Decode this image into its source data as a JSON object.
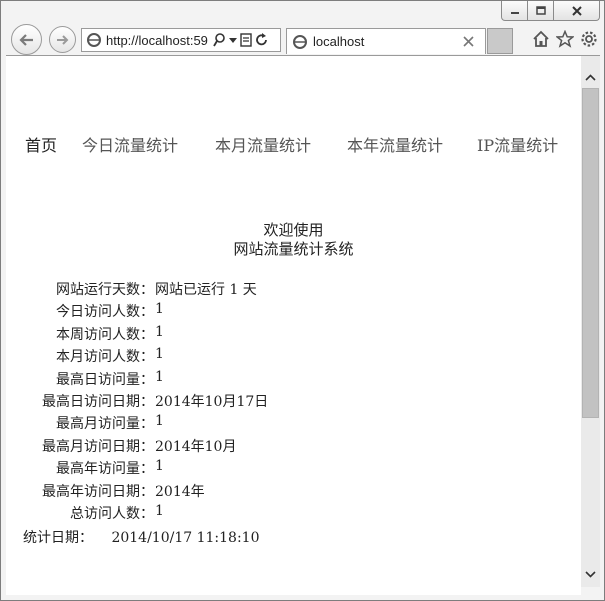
{
  "browser": {
    "address_url": "http://localhost:59",
    "tab_title": "localhost",
    "icons": [
      "back-arrow-icon",
      "forward-arrow-icon",
      "ie-logo-icon",
      "search-icon",
      "dropdown-icon",
      "compat-icon",
      "refresh-icon",
      "close-icon",
      "home-icon",
      "star-icon",
      "gear-icon",
      "minimize-icon",
      "maximize-icon"
    ]
  },
  "nav": {
    "home": "首页",
    "today": "今日流量统计",
    "month": "本月流量统计",
    "year": "本年流量统计",
    "ip": "IP流量统计"
  },
  "welcome": {
    "line1": "欢迎使用",
    "line2": "网站流量统计系统"
  },
  "stats": [
    {
      "label": "网站运行天数：",
      "value": "网站已运行 1 天"
    },
    {
      "label": "今日访问人数：",
      "value": "1"
    },
    {
      "label": "本周访问人数：",
      "value": "1"
    },
    {
      "label": "本月访问人数：",
      "value": "1"
    },
    {
      "label": "最高日访问量：",
      "value": "1"
    },
    {
      "label": "最高日访问日期：",
      "value": "2014年10月17日"
    },
    {
      "label": "最高月访问量：",
      "value": "1"
    },
    {
      "label": "最高月访问日期：",
      "value": "2014年10月"
    },
    {
      "label": "最高年访问量：",
      "value": "1"
    },
    {
      "label": "最高年访问日期：",
      "value": "2014年"
    },
    {
      "label": "总访问人数：",
      "value": "1"
    }
  ],
  "footer": {
    "label": "统计日期：",
    "value": "2014/10/17 11:18:10"
  }
}
